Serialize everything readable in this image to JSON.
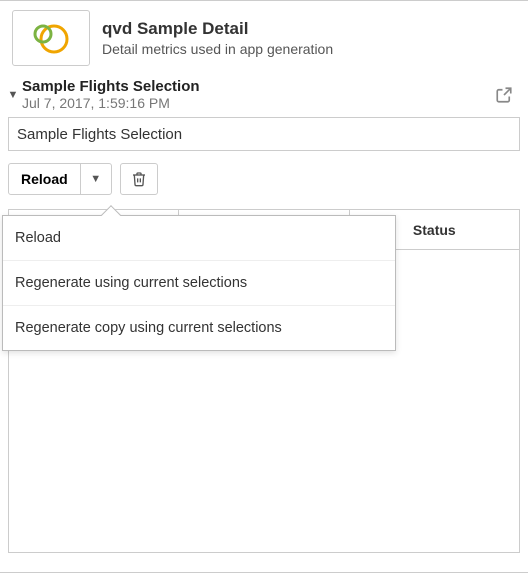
{
  "header": {
    "title": "qvd Sample Detail",
    "subtitle": "Detail metrics used in app generation"
  },
  "detail": {
    "title": "Sample Flights Selection",
    "timestamp": "Jul 7, 2017, 1:59:16 PM"
  },
  "name_input": {
    "value": "Sample Flights Selection"
  },
  "actions": {
    "reload_label": "Reload"
  },
  "dropdown": {
    "items": [
      "Reload",
      "Regenerate using current selections",
      "Regenerate copy using current selections"
    ]
  },
  "table": {
    "columns": [
      "",
      "",
      "Status"
    ]
  }
}
